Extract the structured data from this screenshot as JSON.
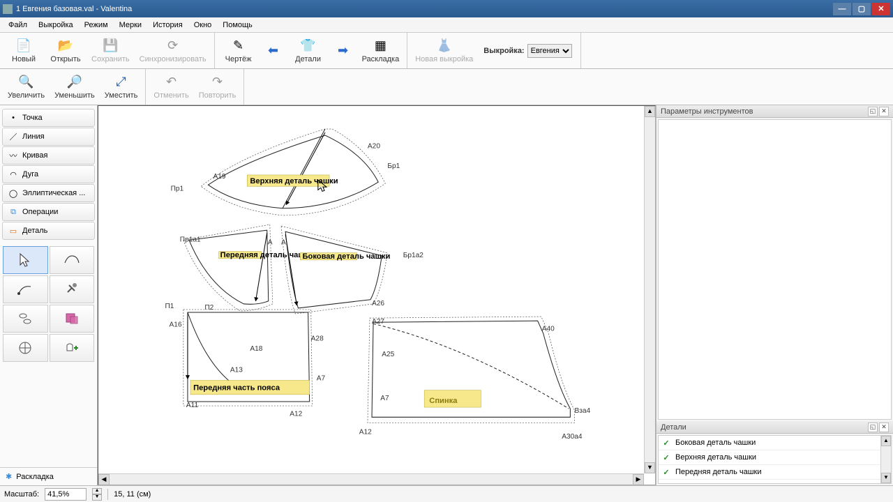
{
  "title": "1 Евгения базовая.val - Valentina",
  "menu": {
    "file": "Файл",
    "pattern": "Выкройка",
    "mode": "Режим",
    "measure": "Мерки",
    "history": "История",
    "window": "Окно",
    "help": "Помощь"
  },
  "toolbar1": {
    "new": "Новый",
    "open": "Открыть",
    "save": "Сохранить",
    "sync": "Синхронизировать",
    "draft": "Чертёж",
    "details": "Детали",
    "layout": "Раскладка",
    "newpattern": "Новая выкройка",
    "pattern_label": "Выкройка:",
    "pattern_value": "Евгения"
  },
  "toolbar2": {
    "zoomin": "Увеличить",
    "zoomout": "Уменьшить",
    "zoomfit": "Уместить",
    "undo": "Отменить",
    "redo": "Повторить"
  },
  "tools": {
    "point": "Точка",
    "line": "Линия",
    "curve": "Кривая",
    "arc": "Дуга",
    "ellipse": "Эллиптическая ...",
    "ops": "Операции",
    "detail": "Деталь",
    "layout": "Раскладка"
  },
  "right": {
    "params_title": "Параметры инструментов",
    "details_title": "Детали",
    "details": [
      "Боковая деталь чашки",
      "Верхняя деталь чашки",
      "Передняя деталь чашки"
    ]
  },
  "canvas": {
    "pts": {
      "A20": "A20",
      "Bp1": "Бр1",
      "A19": "A19",
      "Pr1": "Пр1",
      "Pr1a1": "Пр1а1",
      "A": "A",
      "Bp1a2": "Бр1а2",
      "P1": "П1",
      "P2": "П2",
      "A16": "A16",
      "A18": "A18",
      "A26": "A26",
      "A28": "A28",
      "A13": "A13",
      "A7": "A7",
      "A11": "A11",
      "A12": "A12",
      "A12b": "A12",
      "A25": "A25",
      "A7b": "A7",
      "A40": "A40",
      "Bza4": "Вза4",
      "A30a4": "А30а4",
      "A27": "A27"
    },
    "labels": {
      "top": "Верхняя деталь чашки",
      "front_cup": "Передняя деталь чашки",
      "side_cup": "Боковая деталь чашки",
      "belt_front": "Передняя часть пояса",
      "back": "Спинка"
    }
  },
  "status": {
    "scale_label": "Масштаб:",
    "scale_value": "41,5%",
    "coords": "15, 11 (см)"
  }
}
